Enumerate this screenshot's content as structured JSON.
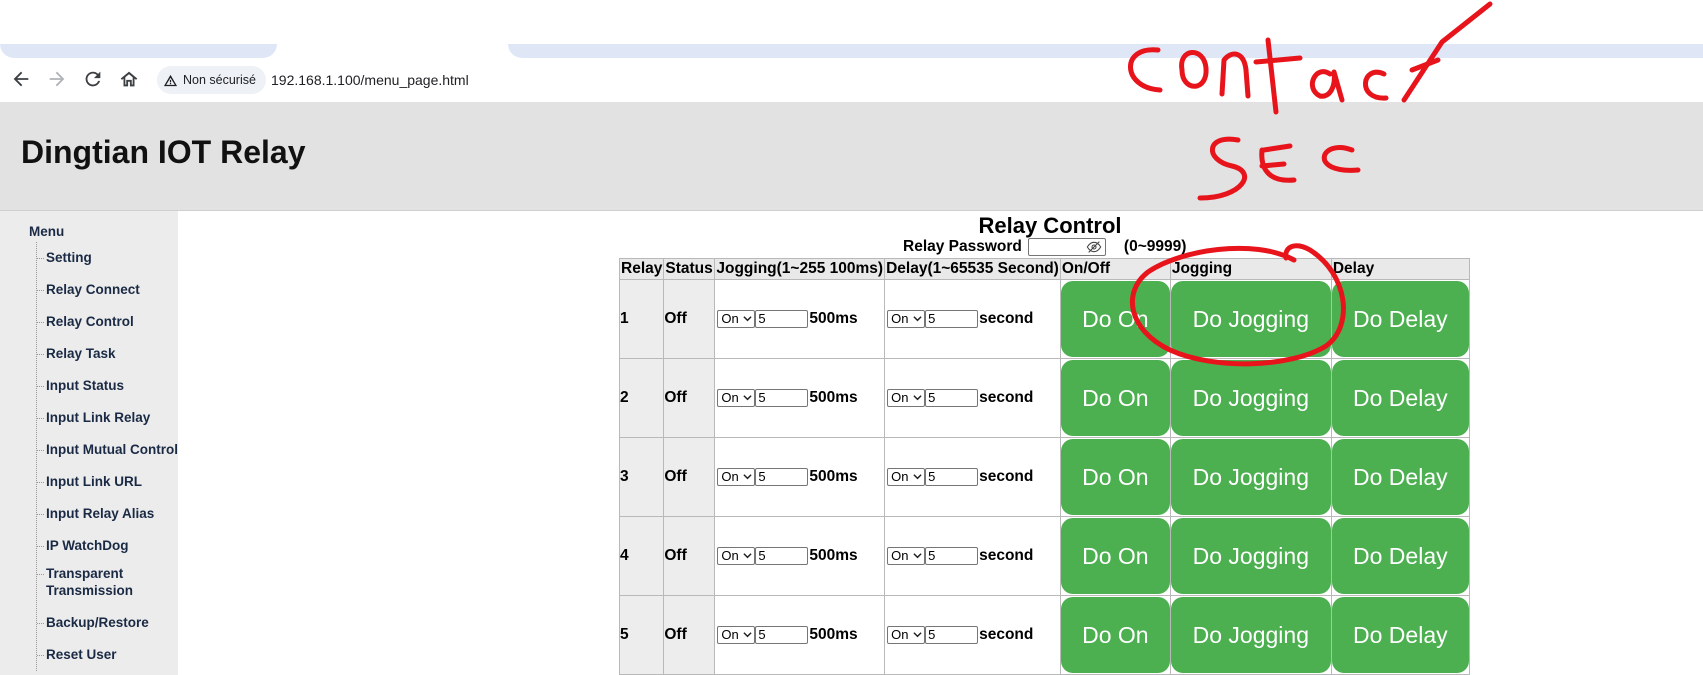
{
  "browser": {
    "security_label": "Non sécurisé",
    "url": "192.168.1.100/menu_page.html"
  },
  "header": {
    "title": "Dingtian IOT Relay"
  },
  "sidebar": {
    "menu_label": "Menu",
    "items": [
      {
        "label": "Setting"
      },
      {
        "label": "Relay Connect"
      },
      {
        "label": "Relay Control"
      },
      {
        "label": "Relay Task"
      },
      {
        "label": "Input Status"
      },
      {
        "label": "Input Link Relay"
      },
      {
        "label": "Input Mutual Control"
      },
      {
        "label": "Input Link URL"
      },
      {
        "label": "Input Relay Alias"
      },
      {
        "label": "IP WatchDog"
      },
      {
        "label": "Transparent Transmission"
      },
      {
        "label": "Backup/Restore"
      },
      {
        "label": "Reset User"
      }
    ]
  },
  "main": {
    "title": "Relay Control",
    "password_label": "Relay Password",
    "password_range": "(0~9999)",
    "columns": [
      "Relay",
      "Status",
      "Jogging(1~255 100ms)",
      "Delay(1~65535 Second)",
      "On/Off",
      "Jogging",
      "Delay"
    ],
    "rows": [
      {
        "relay": "1",
        "status": "Off",
        "jog_mode": "On",
        "jog_value": "5",
        "jog_unit": "500ms",
        "delay_mode": "On",
        "delay_value": "5",
        "delay_unit": "second",
        "on_label": "Do On",
        "jog_label": "Do Jogging",
        "delay_label": "Do Delay"
      },
      {
        "relay": "2",
        "status": "Off",
        "jog_mode": "On",
        "jog_value": "5",
        "jog_unit": "500ms",
        "delay_mode": "On",
        "delay_value": "5",
        "delay_unit": "second",
        "on_label": "Do On",
        "jog_label": "Do Jogging",
        "delay_label": "Do Delay"
      },
      {
        "relay": "3",
        "status": "Off",
        "jog_mode": "On",
        "jog_value": "5",
        "jog_unit": "500ms",
        "delay_mode": "On",
        "delay_value": "5",
        "delay_unit": "second",
        "on_label": "Do On",
        "jog_label": "Do Jogging",
        "delay_label": "Do Delay"
      },
      {
        "relay": "4",
        "status": "Off",
        "jog_mode": "On",
        "jog_value": "5",
        "jog_unit": "500ms",
        "delay_mode": "On",
        "delay_value": "5",
        "delay_unit": "second",
        "on_label": "Do On",
        "jog_label": "Do Jogging",
        "delay_label": "Do Delay"
      },
      {
        "relay": "5",
        "status": "Off",
        "jog_mode": "On",
        "jog_value": "5",
        "jog_unit": "500ms",
        "delay_mode": "On",
        "delay_value": "5",
        "delay_unit": "second",
        "on_label": "Do On",
        "jog_label": "Do Jogging",
        "delay_label": "Do Delay"
      }
    ]
  },
  "annotation": {
    "text_line1": "contact",
    "text_line2": "sec",
    "color": "#e8141c"
  },
  "colors": {
    "button_green": "#4caf50",
    "header_gray": "#e2e2e2",
    "sidebar_gray": "#ececec"
  }
}
